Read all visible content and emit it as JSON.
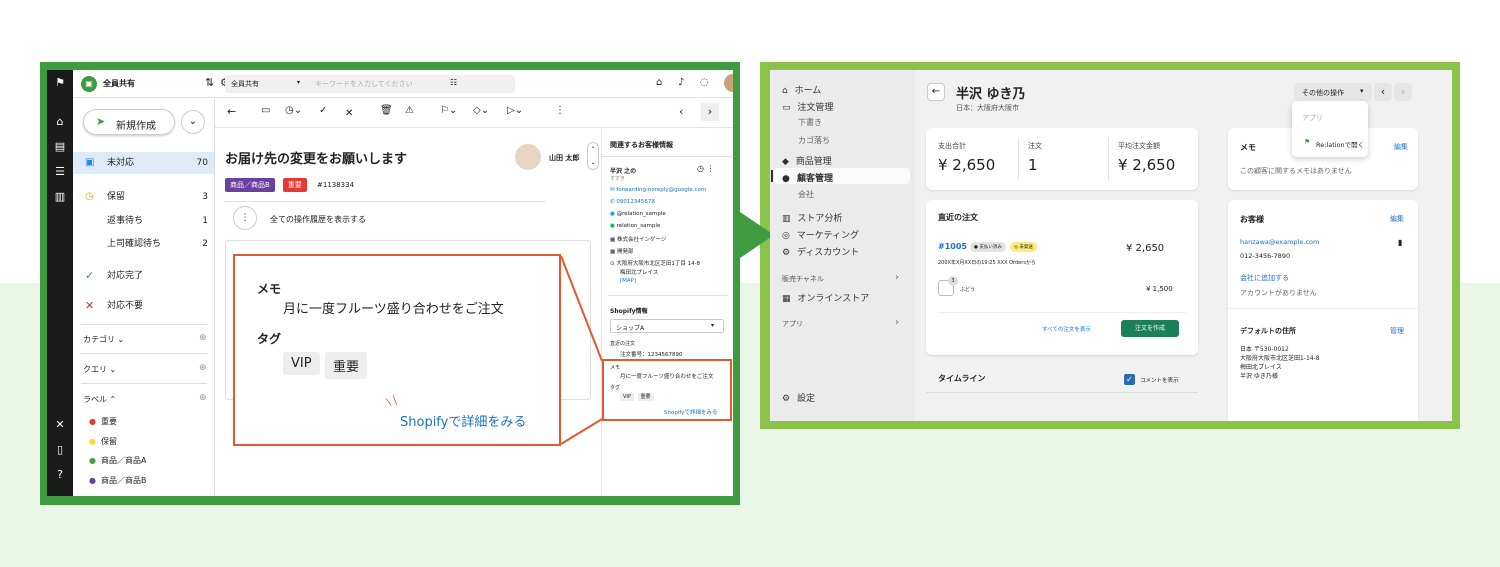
{
  "app": {
    "workspace": "全員共有",
    "search_scope": "全員共有",
    "search_placeholder": "キーワードを入力してください",
    "new_button": "新規作成",
    "sidebar": {
      "unhandled": {
        "label": "未対応",
        "count": "70"
      },
      "hold": {
        "label": "保留",
        "count": "3"
      },
      "reply_wait": {
        "label": "返事待ち",
        "count": "1"
      },
      "boss_check": {
        "label": "上司確認待ち",
        "count": "2"
      },
      "done": {
        "label": "対応完了"
      },
      "no_need": {
        "label": "対応不要"
      },
      "category": "カテゴリ",
      "query": "クエリ",
      "label": "ラベル",
      "labels": [
        {
          "name": "重要",
          "color": "#e53935"
        },
        {
          "name": "保留",
          "color": "#fdd835"
        },
        {
          "name": "商品／商品A",
          "color": "#43a047"
        },
        {
          "name": "商品／商品B",
          "color": "#6a3fa0"
        }
      ]
    },
    "ticket": {
      "title": "お届け先の変更をお願いします",
      "tag1": "商品／商品B",
      "tag2": "重要",
      "ticket_no": "#1138334",
      "assignee": "山田 太郎",
      "history_link": "全ての操作履歴を表示する"
    },
    "overlay": {
      "memo_label": "メモ",
      "memo_text": "月に一度フルーツ盛り合わせをご注文",
      "tag_label": "タグ",
      "tags": [
        "VIP",
        "重要"
      ],
      "link": "Shopifyで詳細をみる"
    },
    "customer_panel": {
      "heading": "関連するお客様情報",
      "name": "半沢 之の",
      "sub": "すすき",
      "email": "forwarding-noreply@google.com",
      "phone": "09012345678",
      "twitter": "@relation_sample",
      "line": "relation_sample",
      "company": "株式会社インゲージ",
      "dept": "開発部",
      "address1": "大阪府大阪市北区芝田1丁目 14-8",
      "address2": "梅田北プレイス",
      "map": "[MAP]",
      "shopify_heading": "Shopify情報",
      "shop_select": "ショップA",
      "recent_order": "直近の注文",
      "order_no": "注文番号：1234567890",
      "memo_label": "メモ",
      "memo_text": "月に一度フルーツ盛り合わせをご注文",
      "tag_label": "タグ",
      "tags": [
        "VIP",
        "重要"
      ],
      "link": "Shopifyで詳細をみる"
    }
  },
  "shopify": {
    "nav": {
      "home": "ホーム",
      "orders": "注文管理",
      "drafts": "下書き",
      "abandoned": "カゴ落ち",
      "products": "商品管理",
      "customers": "顧客管理",
      "companies": "会社",
      "analytics": "ストア分析",
      "marketing": "マーケティング",
      "discounts": "ディスカウント",
      "channels": "販売チャネル",
      "online_store": "オンラインストア",
      "apps": "アプリ",
      "settings": "設定"
    },
    "customer_name": "半沢 ゆき乃",
    "customer_location": "日本：大阪府大阪市",
    "more_actions": "その他の操作",
    "dropdown": {
      "header": "アプリ",
      "item": "Re:lationで開く"
    },
    "stats": [
      {
        "label": "支出合計",
        "value": "¥ 2,650"
      },
      {
        "label": "注文",
        "value": "1"
      },
      {
        "label": "平均注文金額",
        "value": "¥ 2,650"
      }
    ],
    "recent": {
      "heading": "直近の注文",
      "order_id": "#1005",
      "badge1": "支払い済み",
      "badge2": "未発送",
      "amount": "¥ 2,650",
      "date": "200X年X月XX日の19:25 XXX Ordersから",
      "item": "ぶどう",
      "qty": "3",
      "item_price": "¥ 1,500",
      "all_orders": "すべての注文を表示",
      "create_order": "注文を作成"
    },
    "timeline": {
      "heading": "タイムライン",
      "show_comments": "コメントを表示"
    },
    "memo": {
      "heading": "メモ",
      "edit": "編集",
      "empty": "この顧客に関するメモはありません"
    },
    "customer": {
      "heading": "お客様",
      "edit": "編集",
      "email": "hanzawa@example.com",
      "phone": "012-3456-7890",
      "add_company": "会社に追加する",
      "no_account": "アカウントがありません",
      "address_heading": "デフォルトの住所",
      "manage": "管理",
      "addr": [
        "日本 〒530-0012",
        "大阪府大阪市北区芝田1-14-8",
        "梅田北プレイス",
        "半沢 ゆき乃様"
      ]
    }
  }
}
